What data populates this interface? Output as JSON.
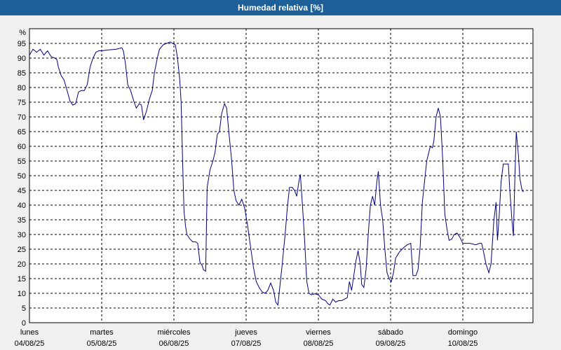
{
  "chart_data": {
    "type": "line",
    "title": "Humedad relativa [%]",
    "ylabel": "%",
    "ylim": [
      0,
      100
    ],
    "yticks": [
      0,
      5,
      10,
      15,
      20,
      25,
      30,
      35,
      40,
      45,
      50,
      55,
      60,
      65,
      70,
      75,
      80,
      85,
      90,
      95
    ],
    "grid": true,
    "colors": {
      "line": "#000080",
      "title_bar": "#1f5f99",
      "plot_bg": "#ffffff",
      "page_bg": "#f0f0f0"
    },
    "day_labels": [
      {
        "day": "lunes",
        "date": "04/08/25"
      },
      {
        "day": "martes",
        "date": "05/08/25"
      },
      {
        "day": "miércoles",
        "date": "06/08/25"
      },
      {
        "day": "jueves",
        "date": "07/08/25"
      },
      {
        "day": "viernes",
        "date": "08/08/25"
      },
      {
        "day": "sábado",
        "date": "09/08/25"
      },
      {
        "day": "domingo",
        "date": "10/08/25"
      }
    ],
    "x_unit": "days since 04/08/25 00:00",
    "series": [
      {
        "values": [
          [
            0.0,
            91.0
          ],
          [
            0.05,
            93.0
          ],
          [
            0.1,
            92.0
          ],
          [
            0.15,
            93.0
          ],
          [
            0.2,
            91.0
          ],
          [
            0.25,
            92.5
          ],
          [
            0.3,
            90.5
          ],
          [
            0.35,
            90.0
          ],
          [
            0.38,
            89.5
          ],
          [
            0.4,
            87.0
          ],
          [
            0.44,
            84.0
          ],
          [
            0.48,
            82.5
          ],
          [
            0.52,
            79.0
          ],
          [
            0.56,
            75.5
          ],
          [
            0.6,
            74.0
          ],
          [
            0.64,
            74.5
          ],
          [
            0.68,
            78.5
          ],
          [
            0.72,
            79.0
          ],
          [
            0.76,
            79.0
          ],
          [
            0.8,
            81.0
          ],
          [
            0.84,
            87.0
          ],
          [
            0.88,
            90.0
          ],
          [
            0.92,
            92.0
          ],
          [
            0.96,
            92.5
          ],
          [
            1.0,
            92.5
          ],
          [
            1.1,
            92.8
          ],
          [
            1.2,
            93.0
          ],
          [
            1.28,
            93.5
          ],
          [
            1.3,
            92.5
          ],
          [
            1.33,
            88.0
          ],
          [
            1.36,
            81.0
          ],
          [
            1.4,
            79.0
          ],
          [
            1.45,
            75.0
          ],
          [
            1.48,
            73.0
          ],
          [
            1.52,
            74.5
          ],
          [
            1.55,
            74.0
          ],
          [
            1.58,
            69.0
          ],
          [
            1.62,
            72.0
          ],
          [
            1.66,
            76.0
          ],
          [
            1.7,
            79.0
          ],
          [
            1.73,
            85.0
          ],
          [
            1.77,
            90.0
          ],
          [
            1.8,
            93.0
          ],
          [
            1.85,
            94.5
          ],
          [
            1.9,
            95.0
          ],
          [
            1.95,
            95.5
          ],
          [
            1.98,
            95.0
          ],
          [
            2.02,
            94.5
          ],
          [
            2.05,
            90.0
          ],
          [
            2.08,
            83.0
          ],
          [
            2.1,
            75.0
          ],
          [
            2.12,
            55.0
          ],
          [
            2.14,
            38.0
          ],
          [
            2.16,
            33.0
          ],
          [
            2.18,
            30.0
          ],
          [
            2.22,
            28.5
          ],
          [
            2.26,
            27.5
          ],
          [
            2.3,
            27.5
          ],
          [
            2.33,
            27.0
          ],
          [
            2.36,
            20.5
          ],
          [
            2.39,
            19.5
          ],
          [
            2.41,
            18.0
          ],
          [
            2.44,
            17.5
          ],
          [
            2.46,
            46.0
          ],
          [
            2.5,
            52.0
          ],
          [
            2.54,
            55.0
          ],
          [
            2.57,
            58.0
          ],
          [
            2.6,
            64.0
          ],
          [
            2.63,
            65.0
          ],
          [
            2.66,
            71.0
          ],
          [
            2.7,
            74.5
          ],
          [
            2.73,
            73.0
          ],
          [
            2.76,
            65.0
          ],
          [
            2.8,
            55.0
          ],
          [
            2.83,
            45.0
          ],
          [
            2.86,
            41.5
          ],
          [
            2.9,
            40.0
          ],
          [
            2.94,
            42.0
          ],
          [
            2.98,
            39.0
          ],
          [
            3.02,
            33.0
          ],
          [
            3.06,
            26.0
          ],
          [
            3.1,
            19.0
          ],
          [
            3.14,
            14.0
          ],
          [
            3.18,
            12.0
          ],
          [
            3.22,
            10.5
          ],
          [
            3.26,
            10.0
          ],
          [
            3.3,
            11.0
          ],
          [
            3.34,
            13.5
          ],
          [
            3.38,
            11.0
          ],
          [
            3.41,
            7.0
          ],
          [
            3.44,
            6.0
          ],
          [
            3.47,
            13.0
          ],
          [
            3.5,
            20.0
          ],
          [
            3.54,
            30.0
          ],
          [
            3.57,
            39.0
          ],
          [
            3.6,
            46.0
          ],
          [
            3.64,
            46.0
          ],
          [
            3.67,
            45.0
          ],
          [
            3.7,
            43.0
          ],
          [
            3.73,
            48.0
          ],
          [
            3.75,
            50.5
          ],
          [
            3.78,
            40.0
          ],
          [
            3.81,
            28.0
          ],
          [
            3.84,
            14.0
          ],
          [
            3.87,
            10.0
          ],
          [
            3.9,
            9.5
          ],
          [
            3.95,
            9.8
          ],
          [
            4.0,
            9.5
          ],
          [
            4.05,
            8.0
          ],
          [
            4.1,
            7.5
          ],
          [
            4.13,
            6.5
          ],
          [
            4.16,
            6.0
          ],
          [
            4.2,
            8.0
          ],
          [
            4.24,
            7.0
          ],
          [
            4.28,
            7.5
          ],
          [
            4.32,
            7.5
          ],
          [
            4.36,
            8.0
          ],
          [
            4.4,
            8.5
          ],
          [
            4.43,
            14.0
          ],
          [
            4.46,
            11.0
          ],
          [
            4.49,
            16.0
          ],
          [
            4.52,
            21.0
          ],
          [
            4.55,
            24.5
          ],
          [
            4.58,
            20.0
          ],
          [
            4.6,
            13.0
          ],
          [
            4.63,
            12.0
          ],
          [
            4.66,
            18.0
          ],
          [
            4.69,
            30.0
          ],
          [
            4.72,
            40.0
          ],
          [
            4.75,
            43.0
          ],
          [
            4.78,
            40.0
          ],
          [
            4.81,
            48.0
          ],
          [
            4.83,
            51.5
          ],
          [
            4.86,
            40.0
          ],
          [
            4.89,
            35.0
          ],
          [
            4.92,
            25.0
          ],
          [
            4.95,
            17.0
          ],
          [
            4.98,
            15.0
          ],
          [
            5.01,
            14.0
          ],
          [
            5.04,
            17.0
          ],
          [
            5.07,
            22.0
          ],
          [
            5.12,
            24.0
          ],
          [
            5.18,
            25.5
          ],
          [
            5.23,
            26.5
          ],
          [
            5.28,
            27.0
          ],
          [
            5.31,
            16.0
          ],
          [
            5.35,
            16.0
          ],
          [
            5.38,
            18.0
          ],
          [
            5.41,
            26.0
          ],
          [
            5.44,
            41.0
          ],
          [
            5.47,
            48.0
          ],
          [
            5.5,
            55.0
          ],
          [
            5.53,
            58.0
          ],
          [
            5.55,
            60.0
          ],
          [
            5.58,
            59.5
          ],
          [
            5.6,
            62.0
          ],
          [
            5.63,
            70.0
          ],
          [
            5.66,
            73.0
          ],
          [
            5.69,
            70.0
          ],
          [
            5.72,
            56.0
          ],
          [
            5.75,
            37.0
          ],
          [
            5.78,
            32.0
          ],
          [
            5.81,
            28.0
          ],
          [
            5.85,
            28.5
          ],
          [
            5.88,
            30.0
          ],
          [
            5.92,
            30.5
          ],
          [
            5.96,
            29.0
          ],
          [
            6.0,
            27.0
          ],
          [
            6.1,
            27.0
          ],
          [
            6.18,
            26.5
          ],
          [
            6.23,
            27.0
          ],
          [
            6.26,
            27.0
          ],
          [
            6.28,
            25.0
          ],
          [
            6.32,
            20.0
          ],
          [
            6.36,
            17.0
          ],
          [
            6.39,
            20.0
          ],
          [
            6.43,
            35.0
          ],
          [
            6.46,
            41.0
          ],
          [
            6.48,
            28.0
          ],
          [
            6.5,
            35.0
          ],
          [
            6.53,
            48.0
          ],
          [
            6.56,
            54.0
          ],
          [
            6.6,
            54.0
          ],
          [
            6.63,
            54.0
          ],
          [
            6.65,
            45.0
          ],
          [
            6.68,
            35.0
          ],
          [
            6.7,
            29.5
          ],
          [
            6.72,
            49.0
          ],
          [
            6.74,
            65.0
          ],
          [
            6.77,
            57.0
          ],
          [
            6.79,
            49.0
          ],
          [
            6.82,
            45.0
          ],
          [
            6.84,
            44.5
          ]
        ]
      }
    ]
  }
}
